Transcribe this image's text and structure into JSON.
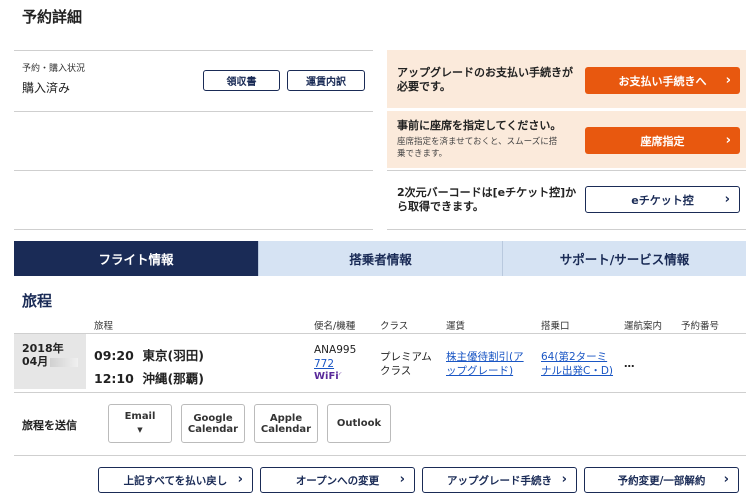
{
  "page_title": "予約詳細",
  "status": {
    "label": "予約・購入状況",
    "value": "購入済み",
    "receipt_label": "領収書",
    "fare_breakdown_label": "運賃内訳"
  },
  "actions": {
    "upgrade_text": "アップグレードのお支払い手続きが必要です。",
    "upgrade_button": "お支払い手続きへ",
    "seat_title": "事前に座席を指定してください。",
    "seat_sub": "座席指定を済ませておくと、スムーズに搭乗できます。",
    "seat_button": "座席指定",
    "barcode_text": "2次元バーコードは[eチケット控]から取得できます。",
    "eticket_button": "eチケット控"
  },
  "tabs": [
    "フライト情報",
    "搭乗者情報",
    "サポート/サービス情報"
  ],
  "itinerary": {
    "title": "旅程",
    "headers": {
      "route": "旅程",
      "flight": "便名/機種",
      "class": "クラス",
      "fare": "運賃",
      "gate": "搭乗口",
      "ops": "運航案内",
      "booking_no": "予約番号"
    },
    "row": {
      "date_year": "2018年",
      "date_month": "04月",
      "dep_time": "09:20",
      "dep_airport": "東京(羽田)",
      "arr_time": "12:10",
      "arr_airport": "沖縄(那覇)",
      "flight_no": "ANA995",
      "aircraft": "772",
      "wifi": "WiFi",
      "class_line1": "プレミアム",
      "class_line2": "クラス",
      "fare_line1": "株主優待割引(ア",
      "fare_line2": "ップグレード)",
      "gate_line1": "64(第2ターミ",
      "gate_line2": "ナル出発C・D)",
      "ops": "…"
    }
  },
  "share": {
    "label": "旅程を送信",
    "email": "Email",
    "google_l1": "Google",
    "google_l2": "Calendar",
    "apple_l1": "Apple",
    "apple_l2": "Calendar",
    "outlook": "Outlook"
  },
  "bottom_buttons": {
    "refund": "上記すべてを払い戻し",
    "open": "オープンへの変更",
    "upgrade": "アップグレード手続き",
    "change": "予約変更/一部解約"
  },
  "colors": {
    "navy": "#1a2b56",
    "orange": "#e8580f",
    "peach": "#fbeadb",
    "tab_inactive": "#d6e3f3",
    "link": "#1a56c4"
  }
}
